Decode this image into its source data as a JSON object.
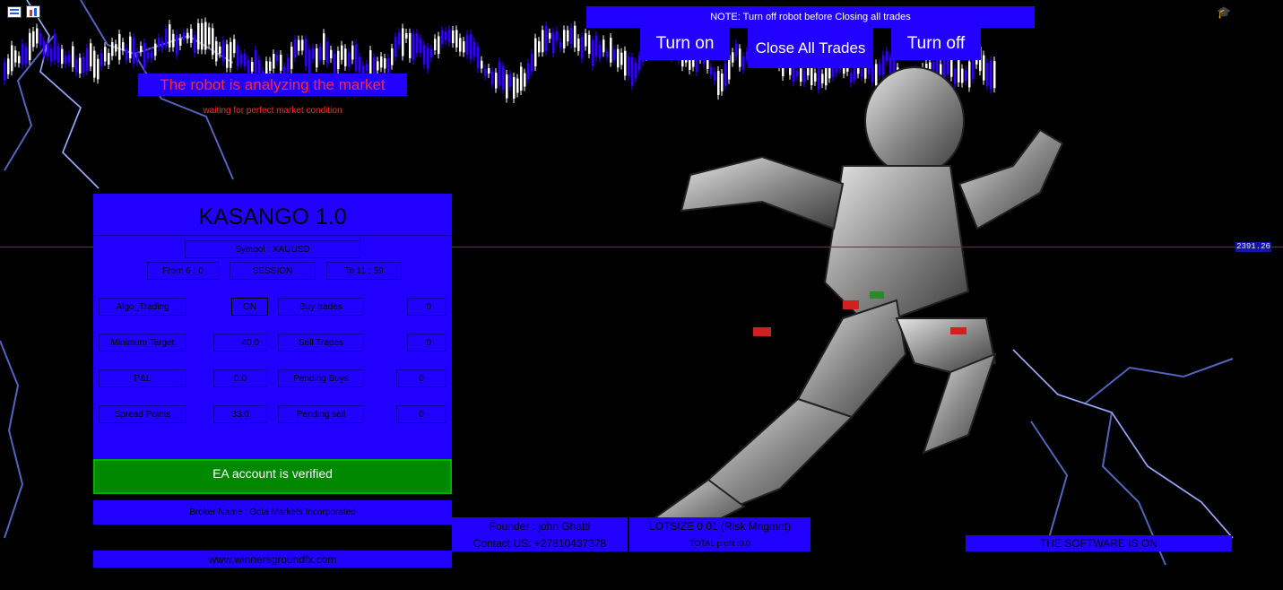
{
  "note": "NOTE: Turn off robot before Closing all trades",
  "buttons": {
    "turn_on": "Turn on",
    "close_all": "Close All Trades",
    "turn_off": "Turn off"
  },
  "status": {
    "headline": "The robot is analyzing the market",
    "sub": "waiting for perfect market condition"
  },
  "panel": {
    "title": "KASANGO 1.0",
    "symbol": "Symbol : XAUUSD",
    "session": {
      "from": "From 6 : 0",
      "label": "SESSION",
      "to": "To 11 : 59"
    },
    "rows": [
      {
        "label": "Algo_Trading",
        "value": "ON",
        "label2": "Buy trades",
        "value2": "0"
      },
      {
        "label": "Minimum Target",
        "value": "40.0",
        "label2": "Sell Trades",
        "value2": "0"
      },
      {
        "label": "P&L",
        "value": "0.0",
        "label2": "Pending Buys",
        "value2": "0"
      },
      {
        "label": "Spread Points",
        "value": "33.0",
        "label2": "Pending sell",
        "value2": "0"
      }
    ],
    "verified": "EA account is verified",
    "broker": "Broker Name : Octa Markets Incorporated",
    "website": "www.winnersgroundfx.com"
  },
  "footer": {
    "founder": "Founder : john Ghatti",
    "contact": "Contact US:  +27810437378",
    "lotsize": "LOTSIZE 0.01 (Risk Mngmnt)",
    "total_profit": "TOTAL profit :0.0",
    "software_status": "THE SOFTWARE IS ON"
  },
  "price_label": "2391.26",
  "colors": {
    "panel_blue": "#2200ff",
    "verified_green": "#008800",
    "alert_red": "#ff2a2a"
  }
}
